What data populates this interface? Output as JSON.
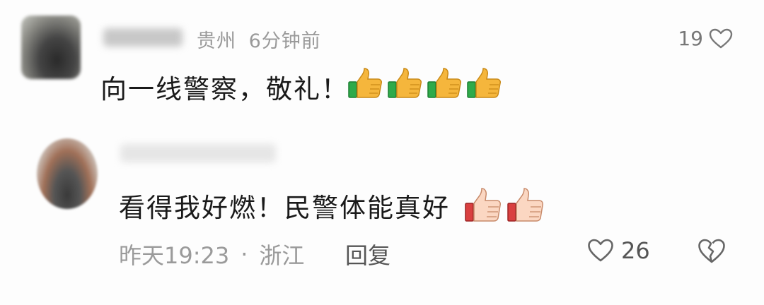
{
  "comment1": {
    "location": "贵州",
    "time": "6分钟前",
    "like_count": "19",
    "text": "向一线警察，敬礼！",
    "emojis": [
      "thumbs-up-icon",
      "thumbs-up-icon",
      "thumbs-up-icon",
      "thumbs-up-icon"
    ]
  },
  "comment2": {
    "text": "看得我好燃！民警体能真好",
    "emojis": [
      "thumbs-up-icon",
      "thumbs-up-icon"
    ],
    "time": "昨天19:23",
    "separator": "·",
    "location": "浙江",
    "reply_label": "回复",
    "like_count": "26"
  },
  "colors": {
    "text_primary": "#1a1a1a",
    "text_meta": "#9a9a9a",
    "thumb_yellow": "#f5b63c",
    "cuff_green": "#2faa4a",
    "cuff_red": "#d94040"
  }
}
